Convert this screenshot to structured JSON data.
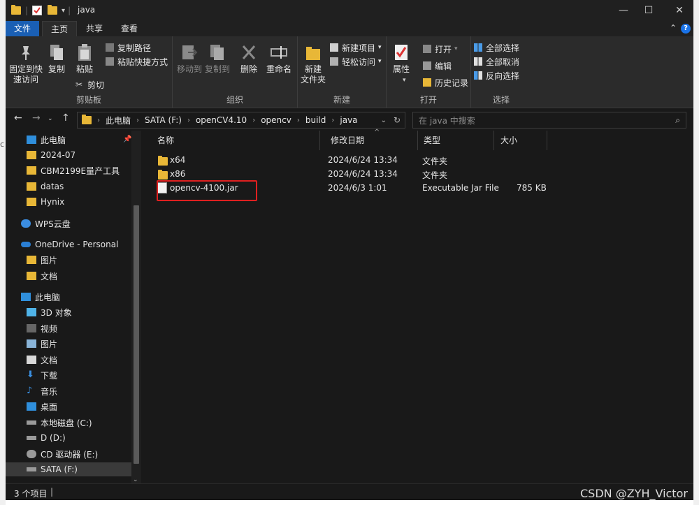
{
  "window": {
    "title": "java",
    "controls": {
      "minimize": "—",
      "maximize": "☐",
      "close": "✕"
    }
  },
  "menu": {
    "tabs": [
      "文件",
      "主页",
      "共享",
      "查看"
    ],
    "active_tab": "主页"
  },
  "ribbon": {
    "clipboard": {
      "label": "剪贴板",
      "pin": "固定到快\n速访问",
      "copy": "复制",
      "paste": "粘贴",
      "copy_path": "复制路径",
      "paste_shortcut": "粘贴快捷方式",
      "cut": "剪切"
    },
    "organize": {
      "label": "组织",
      "move_to": "移动到",
      "copy_to": "复制到",
      "delete": "删除",
      "rename": "重命名"
    },
    "new": {
      "label": "新建",
      "new_folder": "新建\n文件夹",
      "new_item": "新建项目",
      "easy_access": "轻松访问"
    },
    "open": {
      "label": "打开",
      "properties": "属性",
      "open": "打开",
      "edit": "编辑",
      "history": "历史记录"
    },
    "select": {
      "label": "选择",
      "select_all": "全部选择",
      "select_none": "全部取消",
      "invert": "反向选择"
    }
  },
  "address": {
    "crumbs": [
      "此电脑",
      "SATA (F:)",
      "openCV4.10",
      "opencv",
      "build",
      "java"
    ],
    "search_placeholder": "在 java 中搜索"
  },
  "nav_pane": {
    "items": [
      {
        "label": "此电脑",
        "icon": "pc-icon"
      },
      {
        "label": "2024-07",
        "icon": "folder-icon"
      },
      {
        "label": "CBM2199E量产工具",
        "icon": "folder-icon"
      },
      {
        "label": "datas",
        "icon": "folder-icon"
      },
      {
        "label": "Hynix",
        "icon": "folder-icon"
      },
      {
        "label": "WPS云盘",
        "icon": "cloud-icon"
      },
      {
        "label": "OneDrive - Personal",
        "icon": "onedrive-icon"
      },
      {
        "label": "图片",
        "icon": "folder-icon"
      },
      {
        "label": "文档",
        "icon": "folder-icon"
      },
      {
        "label": "此电脑",
        "icon": "pc-icon"
      },
      {
        "label": "3D 对象",
        "icon": "cube-icon"
      },
      {
        "label": "视频",
        "icon": "video-icon"
      },
      {
        "label": "图片",
        "icon": "picture-icon"
      },
      {
        "label": "文档",
        "icon": "document-icon"
      },
      {
        "label": "下载",
        "icon": "download-icon"
      },
      {
        "label": "音乐",
        "icon": "music-icon"
      },
      {
        "label": "桌面",
        "icon": "desktop-icon"
      },
      {
        "label": "本地磁盘 (C:)",
        "icon": "drive-icon"
      },
      {
        "label": "D (D:)",
        "icon": "drive-icon"
      },
      {
        "label": "CD 驱动器 (E:)",
        "icon": "cd-icon"
      },
      {
        "label": "SATA (F:)",
        "icon": "drive-icon"
      }
    ],
    "selected": "SATA (F:)"
  },
  "columns": {
    "name": "名称",
    "date": "修改日期",
    "type": "类型",
    "size": "大小"
  },
  "files": [
    {
      "name": "x64",
      "date": "2024/6/24 13:34",
      "type": "文件夹",
      "size": "",
      "icon": "folder-icon"
    },
    {
      "name": "x86",
      "date": "2024/6/24 13:34",
      "type": "文件夹",
      "size": "",
      "icon": "folder-icon"
    },
    {
      "name": "opencv-4100.jar",
      "date": "2024/6/3 1:01",
      "type": "Executable Jar File",
      "size": "785 KB",
      "icon": "jar-icon"
    }
  ],
  "status": {
    "count": "3 个项目"
  },
  "watermark": "CSDN @ZYH_Victor",
  "colors": {
    "folder": "#e8b737",
    "accent": "#1a5fb4",
    "highlight_box": "#e02020"
  }
}
